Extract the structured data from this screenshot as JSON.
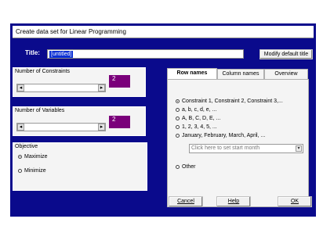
{
  "dialog": {
    "window_title": "Create data set for Linear Programming",
    "title_label": "Title:",
    "title_value": "[untitled]",
    "modify_button": "Modify default title"
  },
  "constraints": {
    "label": "Number of Constraints",
    "value": "2"
  },
  "variables": {
    "label": "Number of Variables",
    "value": "2"
  },
  "objective": {
    "label": "Objective",
    "options": [
      {
        "label": "Maximize",
        "selected": true
      },
      {
        "label": "Minimize",
        "selected": false
      }
    ]
  },
  "tabs": [
    {
      "label": "Row names",
      "active": true
    },
    {
      "label": "Column names",
      "active": false
    },
    {
      "label": "Overview",
      "active": false
    }
  ],
  "row_names": {
    "options": [
      {
        "label": "Constraint 1, Constraint 2, Constraint 3,...",
        "selected": true
      },
      {
        "label": "a, b, c, d, e, ...",
        "selected": false
      },
      {
        "label": "A, B, C, D, E, ...",
        "selected": false
      },
      {
        "label": "1, 2, 3, 4, 5, ...",
        "selected": false
      },
      {
        "label": "January, February, March, April, ...",
        "selected": false
      },
      {
        "label": "Other",
        "selected": false
      }
    ],
    "start_month_placeholder": "Click here to set start month"
  },
  "buttons": {
    "cancel": "Cancel",
    "help": "Help",
    "ok": "OK"
  },
  "colors": {
    "dialog_bg": "#0a0a8c",
    "value_box": "#7a007a"
  }
}
